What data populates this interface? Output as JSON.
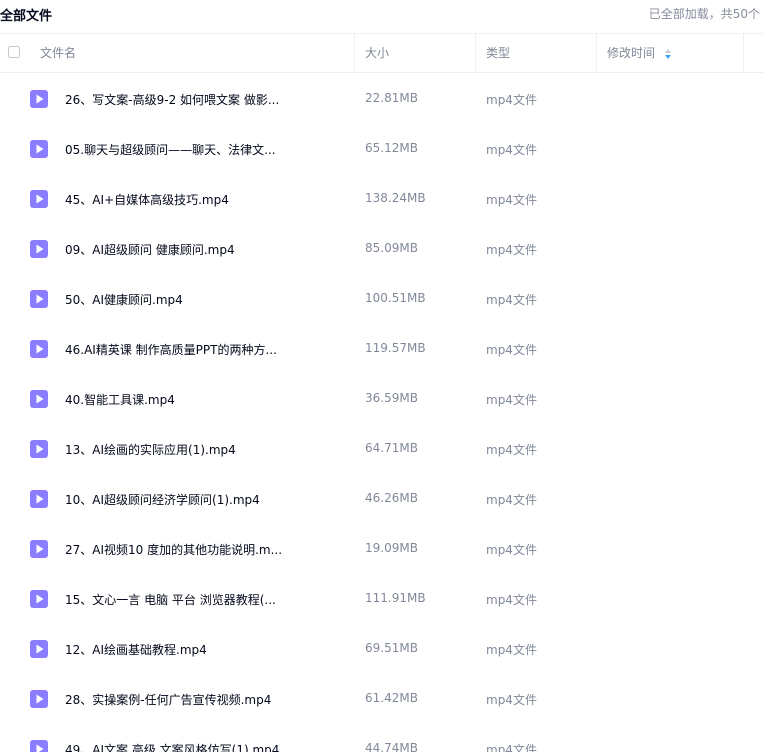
{
  "topbar": {
    "title": "全部文件",
    "loaded_text": "已全部加载，共50个"
  },
  "columns": {
    "name": "文件名",
    "size": "大小",
    "type": "类型",
    "modified": "修改时间"
  },
  "icons": {
    "file": "video-file-icon",
    "sort": "sort-icon",
    "accent": "#8b7dff",
    "sort_color": "#3aa5ff"
  },
  "files": [
    {
      "name": "26、写文案-高级9-2 如何喂文案 做影...",
      "size": "22.81MB",
      "type": "mp4文件"
    },
    {
      "name": "05.聊天与超级顾问——聊天、法律文...",
      "size": "65.12MB",
      "type": "mp4文件"
    },
    {
      "name": "45、AI+自媒体高级技巧.mp4",
      "size": "138.24MB",
      "type": "mp4文件"
    },
    {
      "name": "09、AI超级顾问 健康顾问.mp4",
      "size": "85.09MB",
      "type": "mp4文件"
    },
    {
      "name": "50、AI健康顾问.mp4",
      "size": "100.51MB",
      "type": "mp4文件"
    },
    {
      "name": "46.AI精英课 制作高质量PPT的两种方...",
      "size": "119.57MB",
      "type": "mp4文件"
    },
    {
      "name": "40.智能工具课.mp4",
      "size": "36.59MB",
      "type": "mp4文件"
    },
    {
      "name": "13、AI绘画的实际应用(1).mp4",
      "size": "64.71MB",
      "type": "mp4文件"
    },
    {
      "name": "10、AI超级顾问经济学顾问(1).mp4",
      "size": "46.26MB",
      "type": "mp4文件"
    },
    {
      "name": "27、AI视频10 度加的其他功能说明.m...",
      "size": "19.09MB",
      "type": "mp4文件"
    },
    {
      "name": "15、文心一言 电脑 平台 浏览器教程(...",
      "size": "111.91MB",
      "type": "mp4文件"
    },
    {
      "name": "12、AI绘画基础教程.mp4",
      "size": "69.51MB",
      "type": "mp4文件"
    },
    {
      "name": "28、实操案例-任何广告宣传视频.mp4",
      "size": "61.42MB",
      "type": "mp4文件"
    },
    {
      "name": "49、AI文案 高级 文案风格仿写(1).mp4",
      "size": "44.74MB",
      "type": "mp4文件"
    }
  ]
}
